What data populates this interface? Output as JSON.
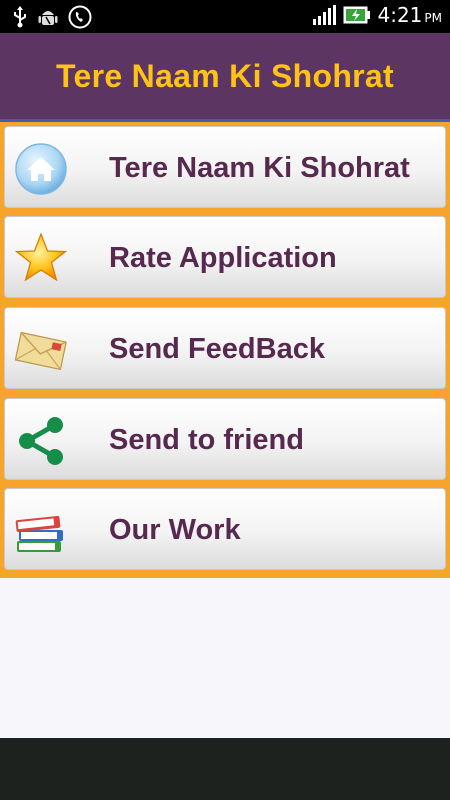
{
  "status_bar": {
    "time": "4:21",
    "ampm": "PM",
    "icons": [
      "usb-icon",
      "android-debug-icon",
      "phone-call-icon",
      "signal-icon",
      "battery-charging-icon"
    ]
  },
  "app": {
    "title": "Tere Naam Ki Shohrat"
  },
  "colors": {
    "titlebar": "#5c3562",
    "title_text": "#ffc218",
    "menu_background": "#f6a42b",
    "item_text": "#57294f"
  },
  "menu": {
    "items": [
      {
        "label": "Tere Naam Ki Shohrat",
        "icon": "home-icon"
      },
      {
        "label": "Rate Application",
        "icon": "star-icon"
      },
      {
        "label": "Send FeedBack",
        "icon": "envelope-icon"
      },
      {
        "label": "Send to friend",
        "icon": "share-icon"
      },
      {
        "label": "Our Work",
        "icon": "books-icon"
      }
    ]
  }
}
